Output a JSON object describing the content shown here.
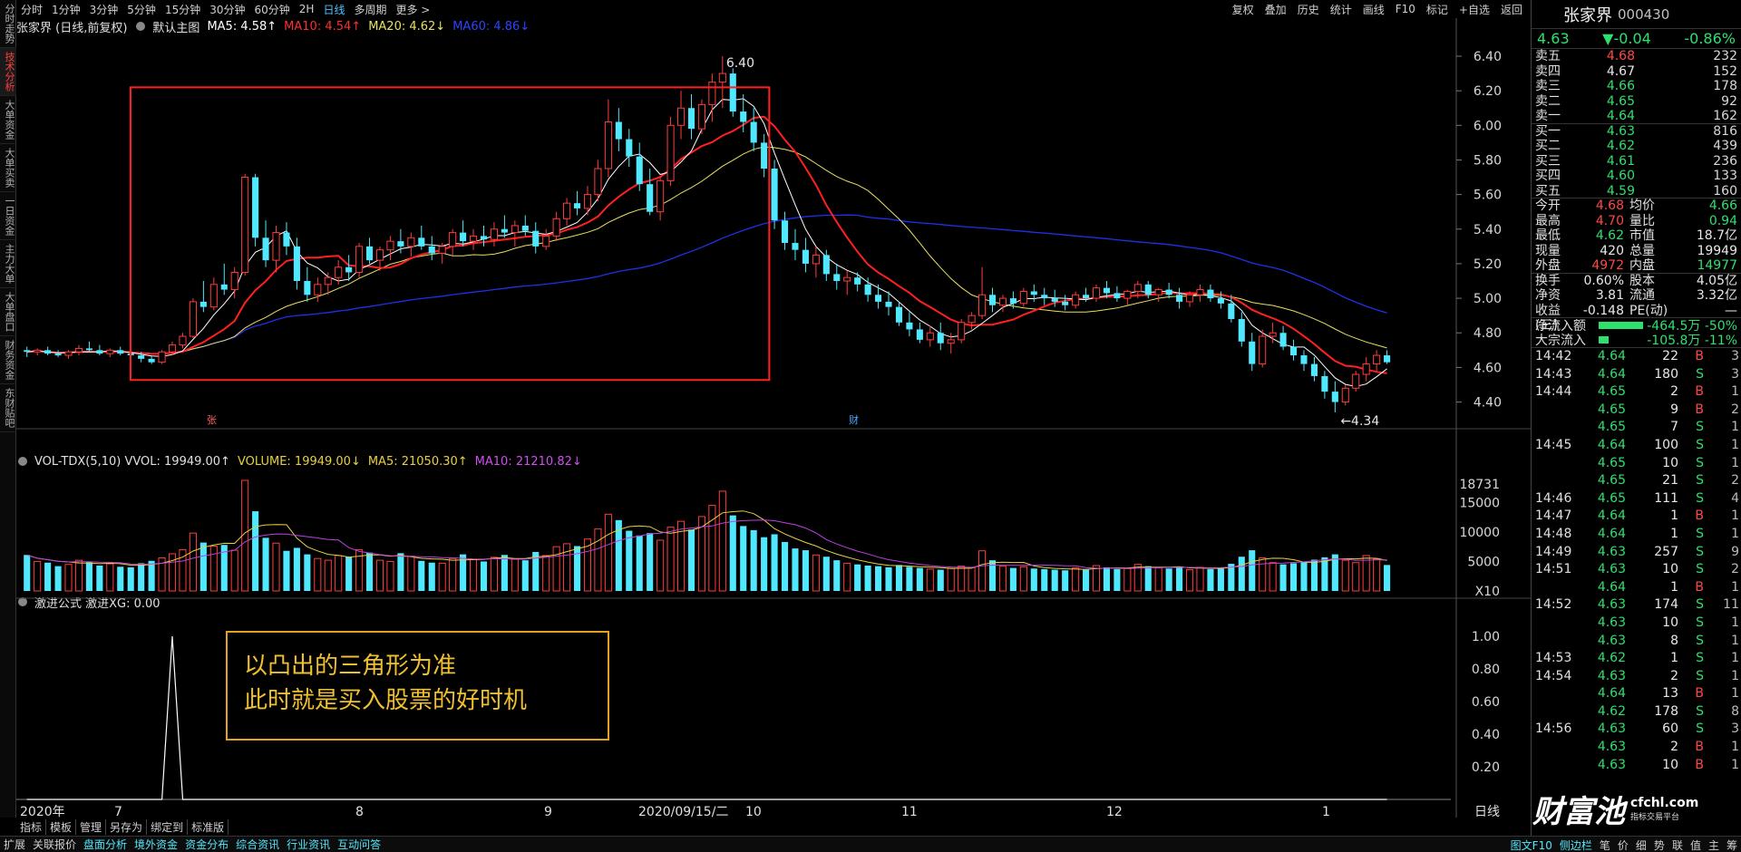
{
  "left_tabs": [
    "分时走势",
    "技术分析",
    "大单资金",
    "大单买卖",
    "一日资金",
    "主力大单",
    "大单盘口",
    "财务资金",
    "东财贴吧"
  ],
  "left_tab_active": 1,
  "periods": [
    "分时",
    "1分钟",
    "3分钟",
    "5分钟",
    "15分钟",
    "30分钟",
    "60分钟",
    "2H",
    "日线",
    "多周期",
    "更多 >"
  ],
  "period_active": 8,
  "toolbar": [
    "复权",
    "叠加",
    "历史",
    "统计",
    "画线",
    "F10",
    "标记",
    "+自选",
    "返回"
  ],
  "main_info": {
    "title": "张家界 (日线,前复权)",
    "mode": "默认主图",
    "ma5": "MA5: 4.58↑",
    "ma10": "MA10: 4.54↑",
    "ma20": "MA20: 4.62↓",
    "ma60": "MA60: 4.86↓"
  },
  "vol_info": {
    "title": "VOL-TDX(5,10) VVOL: 19949.00↑",
    "volume": "VOLUME: 19949.00↓",
    "ma5": "MA5: 21050.30↑",
    "ma10": "MA10: 21210.82↓"
  },
  "ind_info": {
    "title": "激进公式 激进XG: 0.00"
  },
  "price_axis": [
    "6.40",
    "6.20",
    "6.00",
    "5.80",
    "5.60",
    "5.40",
    "5.20",
    "5.00",
    "4.80",
    "4.60",
    "4.40"
  ],
  "vol_axis": [
    "18731",
    "15000",
    "10000",
    "5000",
    "X10"
  ],
  "ind_axis": [
    "1.00",
    "0.80",
    "0.60",
    "0.40",
    "0.20"
  ],
  "date_labels": [
    "2020年",
    "7",
    "8",
    "9",
    "2020/09/15/二",
    "10",
    "11",
    "12",
    "1"
  ],
  "high_label": "6.40",
  "low_label": "←4.34",
  "marker_zhang": "张",
  "marker_cai": "财",
  "period_badge": "日线",
  "colors": {
    "up": "#ff3c3c",
    "down": "#4fe8ff",
    "ma5": "#ffffff",
    "ma10": "#ff2020",
    "ma20": "#e8e060",
    "ma60": "#2030e8",
    "vma5": "#e8d040",
    "vma10": "#c040e0",
    "box": "#ff2020"
  },
  "stock": {
    "name": "张家界",
    "code": "000430",
    "price": "4.63",
    "change": "▼-0.04",
    "pct": "-0.86%"
  },
  "sells": [
    {
      "label": "卖五",
      "price": "4.68",
      "vol": "232",
      "color": "red"
    },
    {
      "label": "卖四",
      "price": "4.67",
      "vol": "152",
      "color": "white"
    },
    {
      "label": "卖三",
      "price": "4.66",
      "vol": "178",
      "color": "green"
    },
    {
      "label": "卖二",
      "price": "4.65",
      "vol": "92",
      "color": "green"
    },
    {
      "label": "卖一",
      "price": "4.64",
      "vol": "162",
      "color": "green"
    }
  ],
  "buys": [
    {
      "label": "买一",
      "price": "4.63",
      "vol": "816",
      "color": "green"
    },
    {
      "label": "买二",
      "price": "4.62",
      "vol": "439",
      "color": "green"
    },
    {
      "label": "买三",
      "price": "4.61",
      "vol": "236",
      "color": "green"
    },
    {
      "label": "买四",
      "price": "4.60",
      "vol": "133",
      "color": "green"
    },
    {
      "label": "买五",
      "price": "4.59",
      "vol": "160",
      "color": "green"
    }
  ],
  "stats": [
    {
      "k1": "今开",
      "v1": "4.68",
      "c1": "red",
      "k2": "均价",
      "v2": "4.66",
      "c2": "green"
    },
    {
      "k1": "最高",
      "v1": "4.70",
      "c1": "red",
      "k2": "量比",
      "v2": "0.94",
      "c2": "green"
    },
    {
      "k1": "最低",
      "v1": "4.62",
      "c1": "green",
      "k2": "市值",
      "v2": "18.7亿",
      "c2": "white"
    },
    {
      "k1": "现量",
      "v1": "420",
      "c1": "white",
      "k2": "总量",
      "v2": "19949",
      "c2": "white"
    },
    {
      "k1": "外盘",
      "v1": "4972",
      "c1": "red",
      "k2": "内盘",
      "v2": "14977",
      "c2": "green"
    }
  ],
  "stats2": [
    {
      "k1": "换手",
      "v1": "0.60%",
      "c1": "white",
      "k2": "股本",
      "v2": "4.05亿",
      "c2": "white"
    },
    {
      "k1": "净资",
      "v1": "3.81",
      "c1": "white",
      "k2": "流通",
      "v2": "3.32亿",
      "c2": "white"
    },
    {
      "k1": "收益(三)",
      "v1": "-0.148",
      "c1": "white",
      "k2": "PE(动)",
      "v2": "—",
      "c2": "white"
    }
  ],
  "flows": [
    {
      "k": "净流入额",
      "v": "-464.5万 -50%",
      "bar": 0.5
    },
    {
      "k": "大宗流入",
      "v": "-105.8万 -11%",
      "bar": 0.11
    }
  ],
  "ticks": [
    {
      "t": "14:42",
      "p": "4.64",
      "v": "22",
      "s": "B",
      "n": "3"
    },
    {
      "t": "14:43",
      "p": "4.64",
      "v": "180",
      "s": "S",
      "n": "3"
    },
    {
      "t": "14:44",
      "p": "4.65",
      "v": "2",
      "s": "B",
      "n": "1"
    },
    {
      "t": "",
      "p": "4.65",
      "v": "9",
      "s": "B",
      "n": "2"
    },
    {
      "t": "",
      "p": "4.65",
      "v": "7",
      "s": "S",
      "n": "1"
    },
    {
      "t": "14:45",
      "p": "4.64",
      "v": "100",
      "s": "S",
      "n": "1"
    },
    {
      "t": "",
      "p": "4.65",
      "v": "10",
      "s": "S",
      "n": "1"
    },
    {
      "t": "",
      "p": "4.65",
      "v": "21",
      "s": "S",
      "n": "2"
    },
    {
      "t": "14:46",
      "p": "4.65",
      "v": "111",
      "s": "S",
      "n": "4"
    },
    {
      "t": "14:47",
      "p": "4.64",
      "v": "1",
      "s": "B",
      "n": "1"
    },
    {
      "t": "14:48",
      "p": "4.64",
      "v": "1",
      "s": "S",
      "n": "1"
    },
    {
      "t": "14:49",
      "p": "4.63",
      "v": "257",
      "s": "S",
      "n": "9"
    },
    {
      "t": "14:51",
      "p": "4.63",
      "v": "10",
      "s": "S",
      "n": "2"
    },
    {
      "t": "",
      "p": "4.64",
      "v": "1",
      "s": "B",
      "n": "1"
    },
    {
      "t": "14:52",
      "p": "4.63",
      "v": "174",
      "s": "S",
      "n": "11"
    },
    {
      "t": "",
      "p": "4.63",
      "v": "10",
      "s": "S",
      "n": "1"
    },
    {
      "t": "",
      "p": "4.63",
      "v": "8",
      "s": "S",
      "n": "1"
    },
    {
      "t": "14:53",
      "p": "4.62",
      "v": "1",
      "s": "S",
      "n": "1"
    },
    {
      "t": "14:54",
      "p": "4.63",
      "v": "2",
      "s": "S",
      "n": "1"
    },
    {
      "t": "",
      "p": "4.64",
      "v": "13",
      "s": "B",
      "n": "1"
    },
    {
      "t": "",
      "p": "4.62",
      "v": "178",
      "s": "S",
      "n": "8"
    },
    {
      "t": "14:56",
      "p": "4.63",
      "v": "60",
      "s": "S",
      "n": "3"
    },
    {
      "t": "",
      "p": "4.63",
      "v": "2",
      "s": "B",
      "n": "1"
    },
    {
      "t": "",
      "p": "4.63",
      "v": "10",
      "s": "B",
      "n": "1"
    }
  ],
  "subtabs": [
    "指标",
    "模板",
    "管理",
    "另存为",
    "绑定到",
    "标准版"
  ],
  "status_tabs": [
    "扩展",
    "关联报价",
    "盘面分析",
    "境外资金",
    "资金分布",
    "综合资讯",
    "行业资讯",
    "互动问答"
  ],
  "status_right": [
    "图文F10",
    "侧边栏",
    "笔",
    "价",
    "细",
    "势",
    "联",
    "值",
    "主",
    "筹"
  ],
  "note": [
    "以凸出的三角形为准",
    "此时就是买入股票的好时机"
  ],
  "logo": {
    "main": "财富池",
    "url": "cfchl.com",
    "tag": "指标交易平台"
  },
  "chart_data": {
    "type": "candlestick",
    "price_range": [
      4.34,
      6.4
    ],
    "vol_range": [
      0,
      18731
    ],
    "ind_range": [
      0,
      1
    ],
    "candles": [
      [
        4.7,
        4.72,
        4.66,
        4.69,
        6100
      ],
      [
        4.69,
        4.71,
        4.67,
        4.7,
        5000
      ],
      [
        4.7,
        4.72,
        4.67,
        4.68,
        4800
      ],
      [
        4.68,
        4.7,
        4.66,
        4.67,
        4200
      ],
      [
        4.67,
        4.7,
        4.65,
        4.69,
        4500
      ],
      [
        4.69,
        4.73,
        4.67,
        4.71,
        5200
      ],
      [
        4.71,
        4.75,
        4.69,
        4.7,
        4900
      ],
      [
        4.7,
        4.73,
        4.67,
        4.68,
        4300
      ],
      [
        4.68,
        4.71,
        4.66,
        4.7,
        4600
      ],
      [
        4.7,
        4.72,
        4.67,
        4.68,
        4100
      ],
      [
        4.68,
        4.7,
        4.65,
        4.67,
        4000
      ],
      [
        4.67,
        4.69,
        4.63,
        4.65,
        4700
      ],
      [
        4.65,
        4.67,
        4.62,
        4.63,
        5100
      ],
      [
        4.63,
        4.7,
        4.62,
        4.69,
        5600
      ],
      [
        4.69,
        4.75,
        4.67,
        4.73,
        6300
      ],
      [
        4.73,
        4.8,
        4.71,
        4.78,
        7000
      ],
      [
        4.78,
        5.0,
        4.77,
        4.98,
        9800
      ],
      [
        4.98,
        5.1,
        4.92,
        4.95,
        8200
      ],
      [
        4.95,
        5.12,
        4.93,
        5.08,
        7600
      ],
      [
        5.08,
        5.2,
        5.02,
        5.05,
        7800
      ],
      [
        5.05,
        5.18,
        5.0,
        5.15,
        6900
      ],
      [
        5.15,
        5.72,
        5.13,
        5.7,
        18731
      ],
      [
        5.7,
        5.72,
        5.3,
        5.35,
        13500
      ],
      [
        5.35,
        5.45,
        5.18,
        5.22,
        9000
      ],
      [
        5.22,
        5.42,
        5.15,
        5.38,
        8100
      ],
      [
        5.38,
        5.44,
        5.25,
        5.3,
        6800
      ],
      [
        5.3,
        5.35,
        5.05,
        5.1,
        7300
      ],
      [
        5.1,
        5.18,
        4.98,
        5.02,
        6200
      ],
      [
        5.02,
        5.12,
        4.98,
        5.08,
        5500
      ],
      [
        5.08,
        5.15,
        5.02,
        5.12,
        5200
      ],
      [
        5.12,
        5.22,
        5.08,
        5.18,
        6000
      ],
      [
        5.18,
        5.25,
        5.1,
        5.15,
        5800
      ],
      [
        5.15,
        5.32,
        5.12,
        5.3,
        7000
      ],
      [
        5.3,
        5.35,
        5.2,
        5.22,
        6500
      ],
      [
        5.22,
        5.3,
        5.16,
        5.28,
        5200
      ],
      [
        5.28,
        5.36,
        5.22,
        5.33,
        5000
      ],
      [
        5.33,
        5.4,
        5.26,
        5.3,
        6400
      ],
      [
        5.3,
        5.38,
        5.24,
        5.35,
        5900
      ],
      [
        5.35,
        5.42,
        5.28,
        5.3,
        5100
      ],
      [
        5.3,
        5.36,
        5.22,
        5.26,
        4800
      ],
      [
        5.26,
        5.32,
        5.2,
        5.3,
        4700
      ],
      [
        5.3,
        5.4,
        5.25,
        5.38,
        5500
      ],
      [
        5.38,
        5.45,
        5.3,
        5.33,
        6200
      ],
      [
        5.33,
        5.4,
        5.28,
        5.36,
        5300
      ],
      [
        5.36,
        5.42,
        5.3,
        5.34,
        5000
      ],
      [
        5.34,
        5.44,
        5.3,
        5.4,
        5700
      ],
      [
        5.4,
        5.48,
        5.35,
        5.38,
        6100
      ],
      [
        5.38,
        5.45,
        5.3,
        5.42,
        5400
      ],
      [
        5.42,
        5.48,
        5.36,
        5.39,
        5200
      ],
      [
        5.39,
        5.44,
        5.26,
        5.3,
        6600
      ],
      [
        5.3,
        5.4,
        5.28,
        5.36,
        6000
      ],
      [
        5.36,
        5.5,
        5.33,
        5.46,
        7500
      ],
      [
        5.46,
        5.58,
        5.42,
        5.55,
        8000
      ],
      [
        5.55,
        5.62,
        5.48,
        5.52,
        7600
      ],
      [
        5.52,
        5.65,
        5.48,
        5.6,
        8800
      ],
      [
        5.6,
        5.8,
        5.56,
        5.75,
        10500
      ],
      [
        5.75,
        6.15,
        5.7,
        6.02,
        13000
      ],
      [
        6.02,
        6.1,
        5.85,
        5.92,
        12000
      ],
      [
        5.92,
        5.98,
        5.76,
        5.82,
        10200
      ],
      [
        5.82,
        5.9,
        5.62,
        5.66,
        9400
      ],
      [
        5.66,
        5.75,
        5.48,
        5.5,
        9800
      ],
      [
        5.5,
        5.7,
        5.45,
        5.68,
        8600
      ],
      [
        5.68,
        6.05,
        5.65,
        6.0,
        10800
      ],
      [
        6.0,
        6.2,
        5.92,
        6.1,
        11800
      ],
      [
        6.1,
        6.18,
        5.92,
        5.98,
        10400
      ],
      [
        5.98,
        6.15,
        5.95,
        6.12,
        12600
      ],
      [
        6.12,
        6.3,
        6.02,
        6.25,
        14500
      ],
      [
        6.25,
        6.4,
        6.1,
        6.3,
        16900
      ],
      [
        6.3,
        6.33,
        6.05,
        6.08,
        12800
      ],
      [
        6.08,
        6.18,
        5.96,
        6.02,
        11000
      ],
      [
        6.02,
        6.1,
        5.85,
        5.9,
        10300
      ],
      [
        5.9,
        5.95,
        5.7,
        5.75,
        9100
      ],
      [
        5.75,
        5.8,
        5.4,
        5.45,
        9600
      ],
      [
        5.45,
        5.5,
        5.28,
        5.32,
        8300
      ],
      [
        5.32,
        5.4,
        5.22,
        5.28,
        7200
      ],
      [
        5.28,
        5.35,
        5.15,
        5.2,
        6900
      ],
      [
        5.2,
        5.3,
        5.12,
        5.25,
        6100
      ],
      [
        5.25,
        5.28,
        5.1,
        5.14,
        5800
      ],
      [
        5.14,
        5.2,
        5.05,
        5.1,
        5200
      ],
      [
        5.1,
        5.16,
        5.02,
        5.12,
        4700
      ],
      [
        5.12,
        5.15,
        5.04,
        5.08,
        4500
      ],
      [
        5.08,
        5.12,
        4.98,
        5.02,
        4300
      ],
      [
        5.02,
        5.08,
        4.94,
        4.98,
        4200
      ],
      [
        4.98,
        5.04,
        4.9,
        4.95,
        4000
      ],
      [
        4.95,
        4.98,
        4.84,
        4.86,
        4400
      ],
      [
        4.86,
        4.92,
        4.78,
        4.82,
        4100
      ],
      [
        4.82,
        4.86,
        4.74,
        4.76,
        3900
      ],
      [
        4.76,
        4.84,
        4.72,
        4.8,
        3700
      ],
      [
        4.8,
        4.86,
        4.7,
        4.74,
        3600
      ],
      [
        4.74,
        4.8,
        4.68,
        4.76,
        3800
      ],
      [
        4.76,
        4.88,
        4.74,
        4.86,
        4200
      ],
      [
        4.86,
        4.92,
        4.82,
        4.9,
        4000
      ],
      [
        4.9,
        5.18,
        4.88,
        5.02,
        6800
      ],
      [
        5.02,
        5.06,
        4.92,
        4.96,
        5200
      ],
      [
        4.96,
        5.02,
        4.92,
        5.0,
        4200
      ],
      [
        5.0,
        5.04,
        4.94,
        4.97,
        3900
      ],
      [
        4.97,
        5.06,
        4.95,
        5.04,
        4100
      ],
      [
        5.04,
        5.08,
        4.98,
        5.02,
        3800
      ],
      [
        5.02,
        5.06,
        4.96,
        5.0,
        3700
      ],
      [
        5.0,
        5.05,
        4.95,
        4.98,
        3600
      ],
      [
        4.98,
        5.02,
        4.93,
        4.96,
        3500
      ],
      [
        4.96,
        5.04,
        4.94,
        5.02,
        3900
      ],
      [
        5.02,
        5.06,
        4.98,
        5.0,
        3600
      ],
      [
        5.0,
        5.08,
        4.98,
        5.06,
        4300
      ],
      [
        5.06,
        5.1,
        5.0,
        5.03,
        4000
      ],
      [
        5.03,
        5.07,
        4.98,
        5.0,
        3700
      ],
      [
        5.0,
        5.05,
        4.96,
        5.04,
        3800
      ],
      [
        5.04,
        5.1,
        5.0,
        5.08,
        4500
      ],
      [
        5.08,
        5.1,
        5.0,
        5.02,
        4200
      ],
      [
        5.02,
        5.06,
        4.98,
        5.05,
        3900
      ],
      [
        5.05,
        5.09,
        5.0,
        5.02,
        3800
      ],
      [
        5.02,
        5.06,
        4.94,
        4.98,
        4100
      ],
      [
        4.98,
        5.04,
        4.95,
        5.02,
        3600
      ],
      [
        5.02,
        5.08,
        4.98,
        5.05,
        4000
      ],
      [
        5.05,
        5.08,
        4.98,
        5.0,
        3700
      ],
      [
        5.0,
        5.04,
        4.94,
        4.97,
        3800
      ],
      [
        4.97,
        5.02,
        4.86,
        4.88,
        4600
      ],
      [
        4.88,
        4.92,
        4.72,
        4.75,
        5800
      ],
      [
        4.75,
        4.8,
        4.58,
        4.62,
        6900
      ],
      [
        4.62,
        4.82,
        4.6,
        4.78,
        5600
      ],
      [
        4.78,
        4.86,
        4.74,
        4.8,
        4800
      ],
      [
        4.8,
        4.84,
        4.7,
        4.72,
        4500
      ],
      [
        4.72,
        4.76,
        4.64,
        4.67,
        4700
      ],
      [
        4.67,
        4.7,
        4.58,
        4.62,
        4900
      ],
      [
        4.62,
        4.66,
        4.52,
        4.55,
        5300
      ],
      [
        4.55,
        4.58,
        4.42,
        4.46,
        5700
      ],
      [
        4.46,
        4.52,
        4.34,
        4.4,
        6200
      ],
      [
        4.4,
        4.5,
        4.38,
        4.48,
        5200
      ],
      [
        4.48,
        4.58,
        4.46,
        4.56,
        4800
      ],
      [
        4.56,
        4.66,
        4.52,
        4.62,
        6000
      ],
      [
        4.62,
        4.7,
        4.58,
        4.67,
        5400
      ],
      [
        4.67,
        4.7,
        4.62,
        4.63,
        4400
      ]
    ],
    "signal_index": 14,
    "box_range": [
      11,
      71
    ]
  }
}
